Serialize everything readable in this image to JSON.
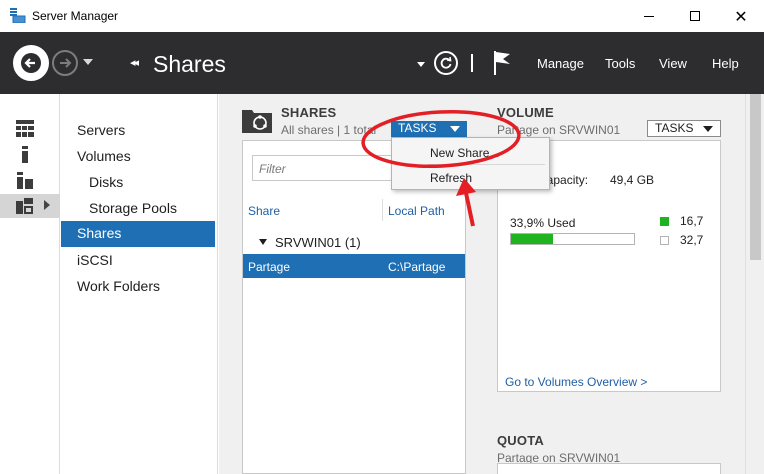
{
  "window": {
    "title": "Server Manager",
    "controls": [
      "minimize",
      "maximize",
      "close"
    ],
    "close_glyph": "✕"
  },
  "toolbar": {
    "breadcrumb_arrows": "◂◂",
    "breadcrumb_title": "Shares",
    "menus": [
      "Manage",
      "Tools",
      "View",
      "Help"
    ]
  },
  "rail": {
    "icons": [
      "dashboard-icon",
      "local-server-icon",
      "all-servers-icon",
      "file-storage-icon"
    ],
    "active": "file-storage-icon"
  },
  "nav": {
    "items": [
      {
        "label": "Servers",
        "level": 1
      },
      {
        "label": "Volumes",
        "level": 1
      },
      {
        "label": "Disks",
        "level": 2
      },
      {
        "label": "Storage Pools",
        "level": 2
      },
      {
        "label": "Shares",
        "level": 1,
        "active": true
      },
      {
        "label": "iSCSI",
        "level": 1
      },
      {
        "label": "Work Folders",
        "level": 1
      }
    ]
  },
  "shares": {
    "title": "SHARES",
    "subtitle": "All shares | 1 total",
    "tasks_label": "TASKS",
    "filter_placeholder": "Filter",
    "columns": [
      "Share",
      "Local Path"
    ],
    "group": {
      "label": "SRVWIN01 (1)"
    },
    "rows": [
      {
        "share": "Partage",
        "local_path": "C:\\Partage",
        "selected": true
      }
    ]
  },
  "tasks_menu": {
    "items": [
      "New Share...",
      "Refresh"
    ]
  },
  "volume": {
    "title": "VOLUME",
    "subtitle": "Partage on SRVWIN01",
    "tasks_label": "TASKS",
    "capacity_label": "Capacity:",
    "capacity_value": "49,4 GB",
    "used_label": "33,9% Used",
    "used_fraction": 0.339,
    "used_value": "16,7",
    "free_value": "32,7",
    "link": "Go to Volumes Overview >"
  },
  "quota": {
    "title": "QUOTA",
    "subtitle": "Partage on SRVWIN01"
  },
  "colors": {
    "toolbar_bg": "#2d2d30",
    "selection": "#1e6fb3",
    "used_bar": "#1fb41f",
    "annotation_red": "#e31e24"
  }
}
